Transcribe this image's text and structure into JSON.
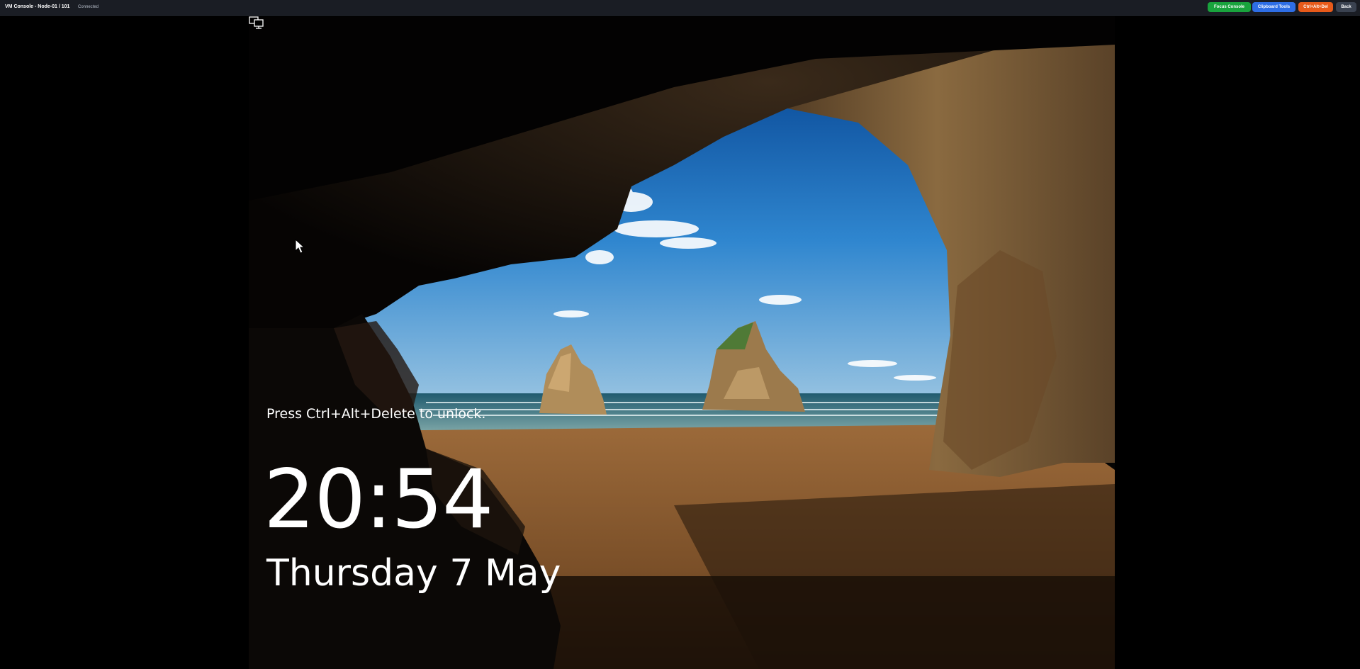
{
  "window": {
    "title": "VM Console - Node-01 / 101",
    "status": "Connected"
  },
  "toolbar": {
    "focus_label": "Focus Console",
    "clipboard_label": "Clipboard Tools",
    "cad_label": "Ctrl+Alt+Del",
    "back_label": "Back"
  },
  "lockscreen": {
    "message": "Press Ctrl+Alt+Delete to unlock.",
    "time": "20:54",
    "date": "Thursday 7 May"
  },
  "icons": {
    "network": "network-icon",
    "cursor": "mouse-pointer-icon"
  },
  "colors": {
    "focus": "#19a33d",
    "clipboard": "#2e6ee6",
    "cad": "#e85a1a",
    "back": "#3a4250"
  }
}
